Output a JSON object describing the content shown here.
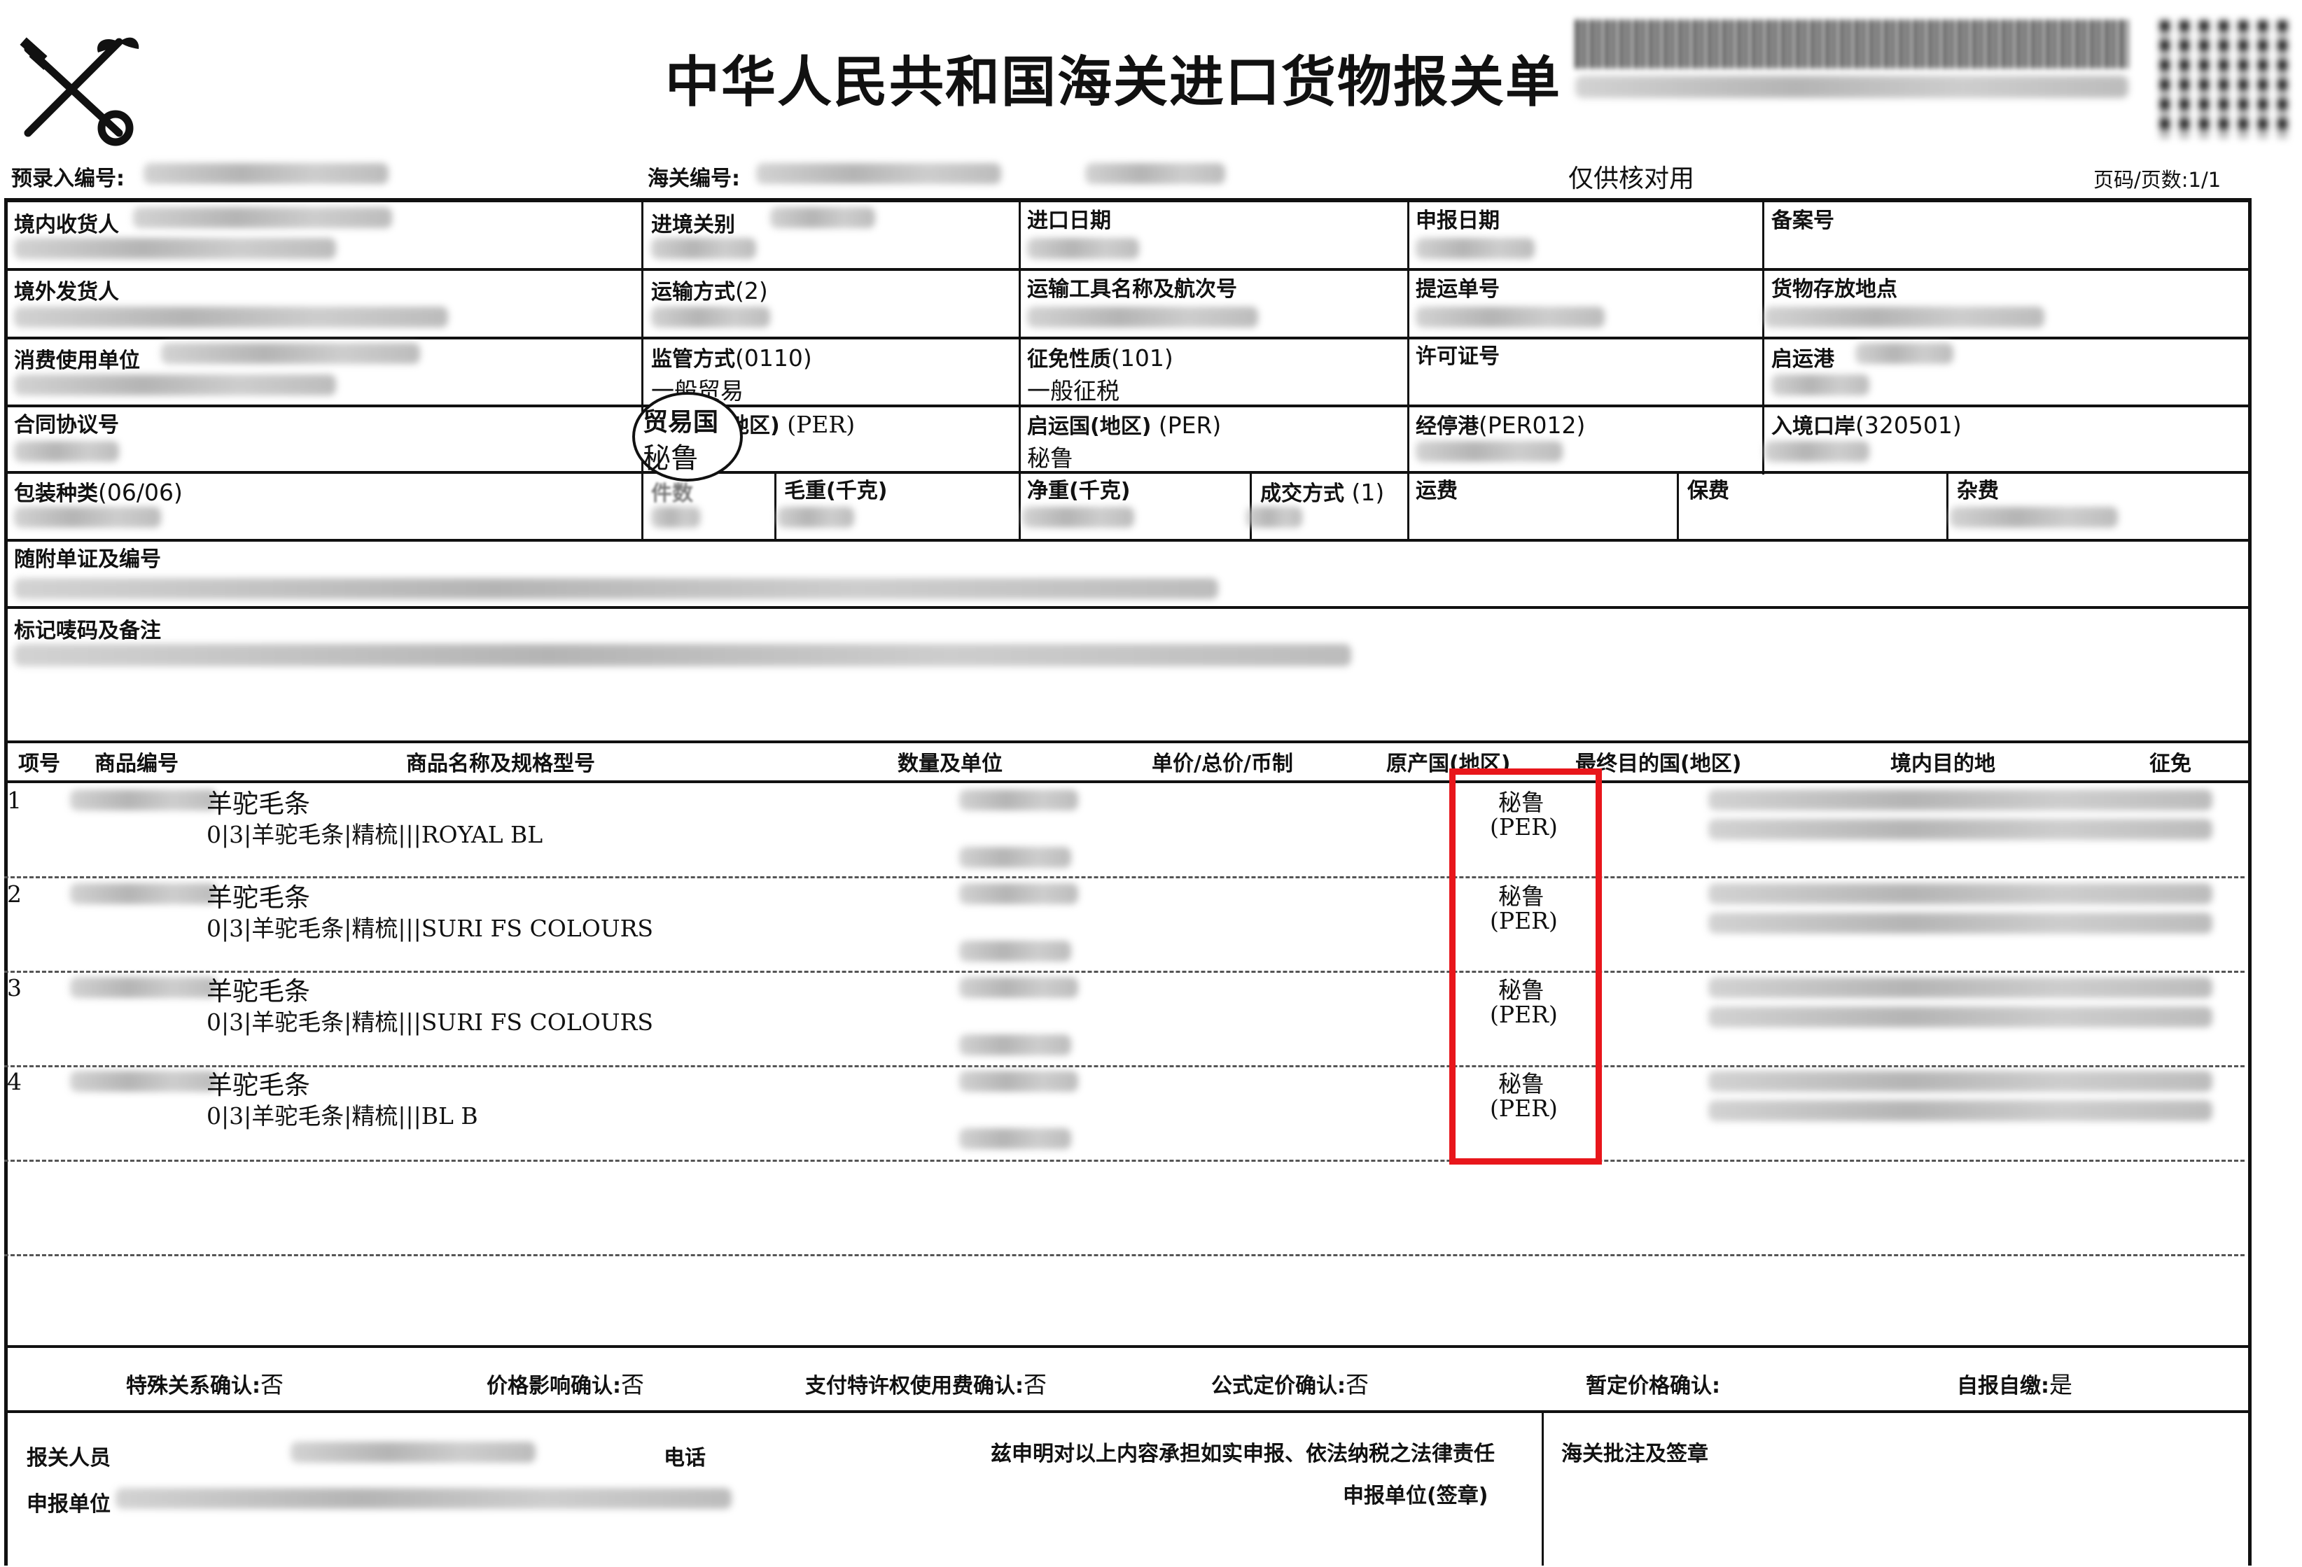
{
  "header": {
    "title": "中华人民共和国海关进口货物报关单",
    "prerecord_label": "预录入编号:",
    "customs_no_label": "海关编号:",
    "verify_note": "仅供核对用",
    "page_info": "页码/页数:1/1"
  },
  "fields": {
    "domestic_consignee": "境内收货人",
    "entry_customs": "进境关别",
    "import_date": "进口日期",
    "declare_date": "申报日期",
    "record_no": "备案号",
    "overseas_consignor": "境外发货人",
    "transport_mode": "运输方式",
    "transport_mode_code": "(2)",
    "vehicle_voyage": "运输工具名称及航次号",
    "bill_no": "提运单号",
    "storage_place": "货物存放地点",
    "consumer_unit": "消费使用单位",
    "supervision_mode": "监管方式",
    "supervision_mode_code": "(0110)",
    "supervision_mode_value": "一般贸易",
    "exemption_nature": "征免性质",
    "exemption_nature_code": "(101)",
    "exemption_nature_value": "一般征税",
    "license_no": "许可证号",
    "departure_port": "启运港",
    "contract_no": "合同协议号",
    "trade_country_stamp_label": "贸易国",
    "trade_country_stamp_value": "秘鲁",
    "trade_country_suffix": "地区)",
    "trade_country_code": "(PER)",
    "departure_country": "启运国(地区)",
    "departure_country_code": "(PER)",
    "departure_country_value": "秘鲁",
    "transit_port": "经停港",
    "transit_port_code": "(PER012)",
    "entry_port": "入境口岸",
    "entry_port_code": "(320501)",
    "package_type": "包装种类",
    "package_type_code": "(06/06)",
    "pieces": "件数",
    "gross_weight": "毛重(千克)",
    "net_weight": "净重(千克)",
    "transaction_mode": "成交方式",
    "transaction_mode_code": "(1)",
    "freight": "运费",
    "insurance": "保费",
    "misc_fee": "杂费",
    "attached_docs": "随附单证及编号",
    "marks_remarks": "标记唛码及备注"
  },
  "goods_table": {
    "headers": {
      "item": "项号",
      "code": "商品编号",
      "name": "商品名称及规格型号",
      "qty": "数量及单位",
      "price": "单价/总价/币制",
      "origin": "原产国(地区)",
      "final_dest": "最终目的国(地区)",
      "domestic_dest": "境内目的地",
      "levy": "征免"
    },
    "rows": [
      {
        "no": "1",
        "name": "羊驼毛条",
        "spec": "0|3|羊驼毛条|精梳|||ROYAL BL",
        "origin": "秘鲁",
        "origin_code": "(PER)"
      },
      {
        "no": "2",
        "name": "羊驼毛条",
        "spec": "0|3|羊驼毛条|精梳|||SURI FS COLOURS",
        "origin": "秘鲁",
        "origin_code": "(PER)"
      },
      {
        "no": "3",
        "name": "羊驼毛条",
        "spec": "0|3|羊驼毛条|精梳|||SURI FS COLOURS",
        "origin": "秘鲁",
        "origin_code": "(PER)"
      },
      {
        "no": "4",
        "name": "羊驼毛条",
        "spec": "0|3|羊驼毛条|精梳|||BL B",
        "origin": "秘鲁",
        "origin_code": "(PER)"
      }
    ]
  },
  "confirmations": {
    "special_relation": "特殊关系确认:",
    "special_relation_value": "否",
    "price_influence": "价格影响确认:",
    "price_influence_value": "否",
    "royalty": "支付特许权使用费确认:",
    "royalty_value": "否",
    "formula_price": "公式定价确认:",
    "formula_price_value": "否",
    "provisional_price": "暂定价格确认:",
    "self_report": "自报自缴:",
    "self_report_value": "是"
  },
  "footer": {
    "declarant": "报关人员",
    "phone": "电话",
    "declaration": "兹申明对以上内容承担如实申报、依法纳税之法律责任",
    "declaring_unit": "申报单位",
    "declaring_unit_seal": "申报单位(签章)",
    "customs_approval": "海关批注及签章"
  },
  "colors": {
    "highlight_box": "#e8161b",
    "ink": "#111111"
  },
  "icons": {
    "emblem": "customs-key-caduceus-icon"
  }
}
